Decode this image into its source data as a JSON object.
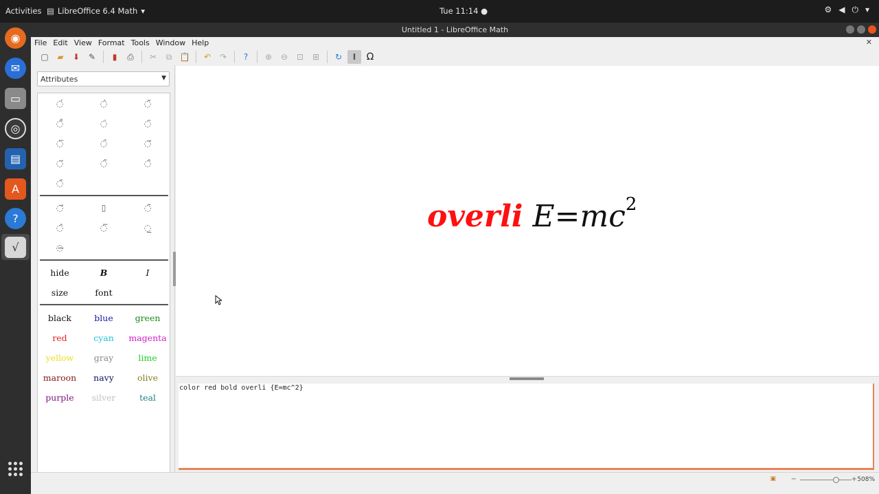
{
  "topbar": {
    "activities": "Activities",
    "app_menu": "LibreOffice 6.4 Math",
    "clock": "Tue 11:14"
  },
  "window": {
    "title": "Untitled 1 - LibreOffice Math"
  },
  "menu": [
    "File",
    "Edit",
    "View",
    "Format",
    "Tools",
    "Window",
    "Help"
  ],
  "sidebar": {
    "category": "Attributes",
    "text_attrs": [
      [
        "hide",
        "B",
        "I"
      ],
      [
        "size",
        "font",
        ""
      ]
    ],
    "colors": [
      {
        "label": "black",
        "color": "#111111"
      },
      {
        "label": "blue",
        "color": "#1a1aa6"
      },
      {
        "label": "green",
        "color": "#1a8a1a"
      },
      {
        "label": "red",
        "color": "#e02020"
      },
      {
        "label": "cyan",
        "color": "#20c0d8"
      },
      {
        "label": "magenta",
        "color": "#d020c8"
      },
      {
        "label": "yellow",
        "color": "#e8e020"
      },
      {
        "label": "gray",
        "color": "#8a8a8a"
      },
      {
        "label": "lime",
        "color": "#20d020"
      },
      {
        "label": "maroon",
        "color": "#801818"
      },
      {
        "label": "navy",
        "color": "#101060"
      },
      {
        "label": "olive",
        "color": "#888020"
      },
      {
        "label": "purple",
        "color": "#801880"
      },
      {
        "label": "silver",
        "color": "#c0c0c0"
      },
      {
        "label": "teal",
        "color": "#208080"
      }
    ]
  },
  "formula": {
    "red_part": "overli",
    "black_part": "E=mc",
    "superscript": "2"
  },
  "editor": {
    "command_text": "color red bold overli {E=mc^2}"
  },
  "statusbar": {
    "zoom": "508%"
  }
}
